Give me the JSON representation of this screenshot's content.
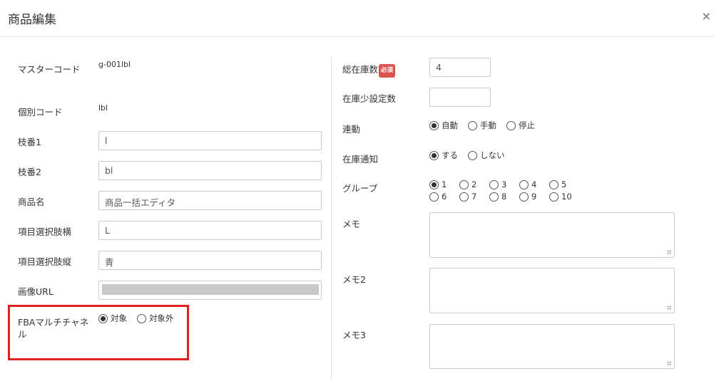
{
  "title": "商品編集",
  "close": "×",
  "left": {
    "master_code": {
      "label": "マスターコード",
      "value": "g-001lbl"
    },
    "item_code": {
      "label": "個別コード",
      "value": "lbl"
    },
    "branch1": {
      "label": "枝番1",
      "value": "l"
    },
    "branch2": {
      "label": "枝番2",
      "value": "bl"
    },
    "product_name": {
      "label": "商品名",
      "value": "商品一括エディタ"
    },
    "option_h": {
      "label": "項目選択肢横",
      "value": "L"
    },
    "option_v": {
      "label": "項目選択肢縦",
      "value": "青"
    },
    "image_url": {
      "label": "画像URL",
      "value": ""
    },
    "fba": {
      "label": "FBAマルチチャネル",
      "options": [
        "対象",
        "対象外"
      ],
      "selected": "対象"
    }
  },
  "right": {
    "total_stock": {
      "label": "総在庫数",
      "badge": "必須",
      "value": "4"
    },
    "low_stock": {
      "label": "在庫少設定数",
      "value": ""
    },
    "sync": {
      "label": "連動",
      "options": [
        "自動",
        "手動",
        "停止"
      ],
      "selected": "自動"
    },
    "notify": {
      "label": "在庫通知",
      "options": [
        "する",
        "しない"
      ],
      "selected": "する"
    },
    "group": {
      "label": "グループ",
      "options": [
        "1",
        "2",
        "3",
        "4",
        "5",
        "6",
        "7",
        "8",
        "9",
        "10"
      ],
      "selected": "1"
    },
    "memo": {
      "label": "メモ",
      "value": ""
    },
    "memo2": {
      "label": "メモ2",
      "value": ""
    },
    "memo3": {
      "label": "メモ3",
      "value": ""
    }
  },
  "colors": {
    "highlight": "#e02020",
    "badge": "#d9534f"
  }
}
